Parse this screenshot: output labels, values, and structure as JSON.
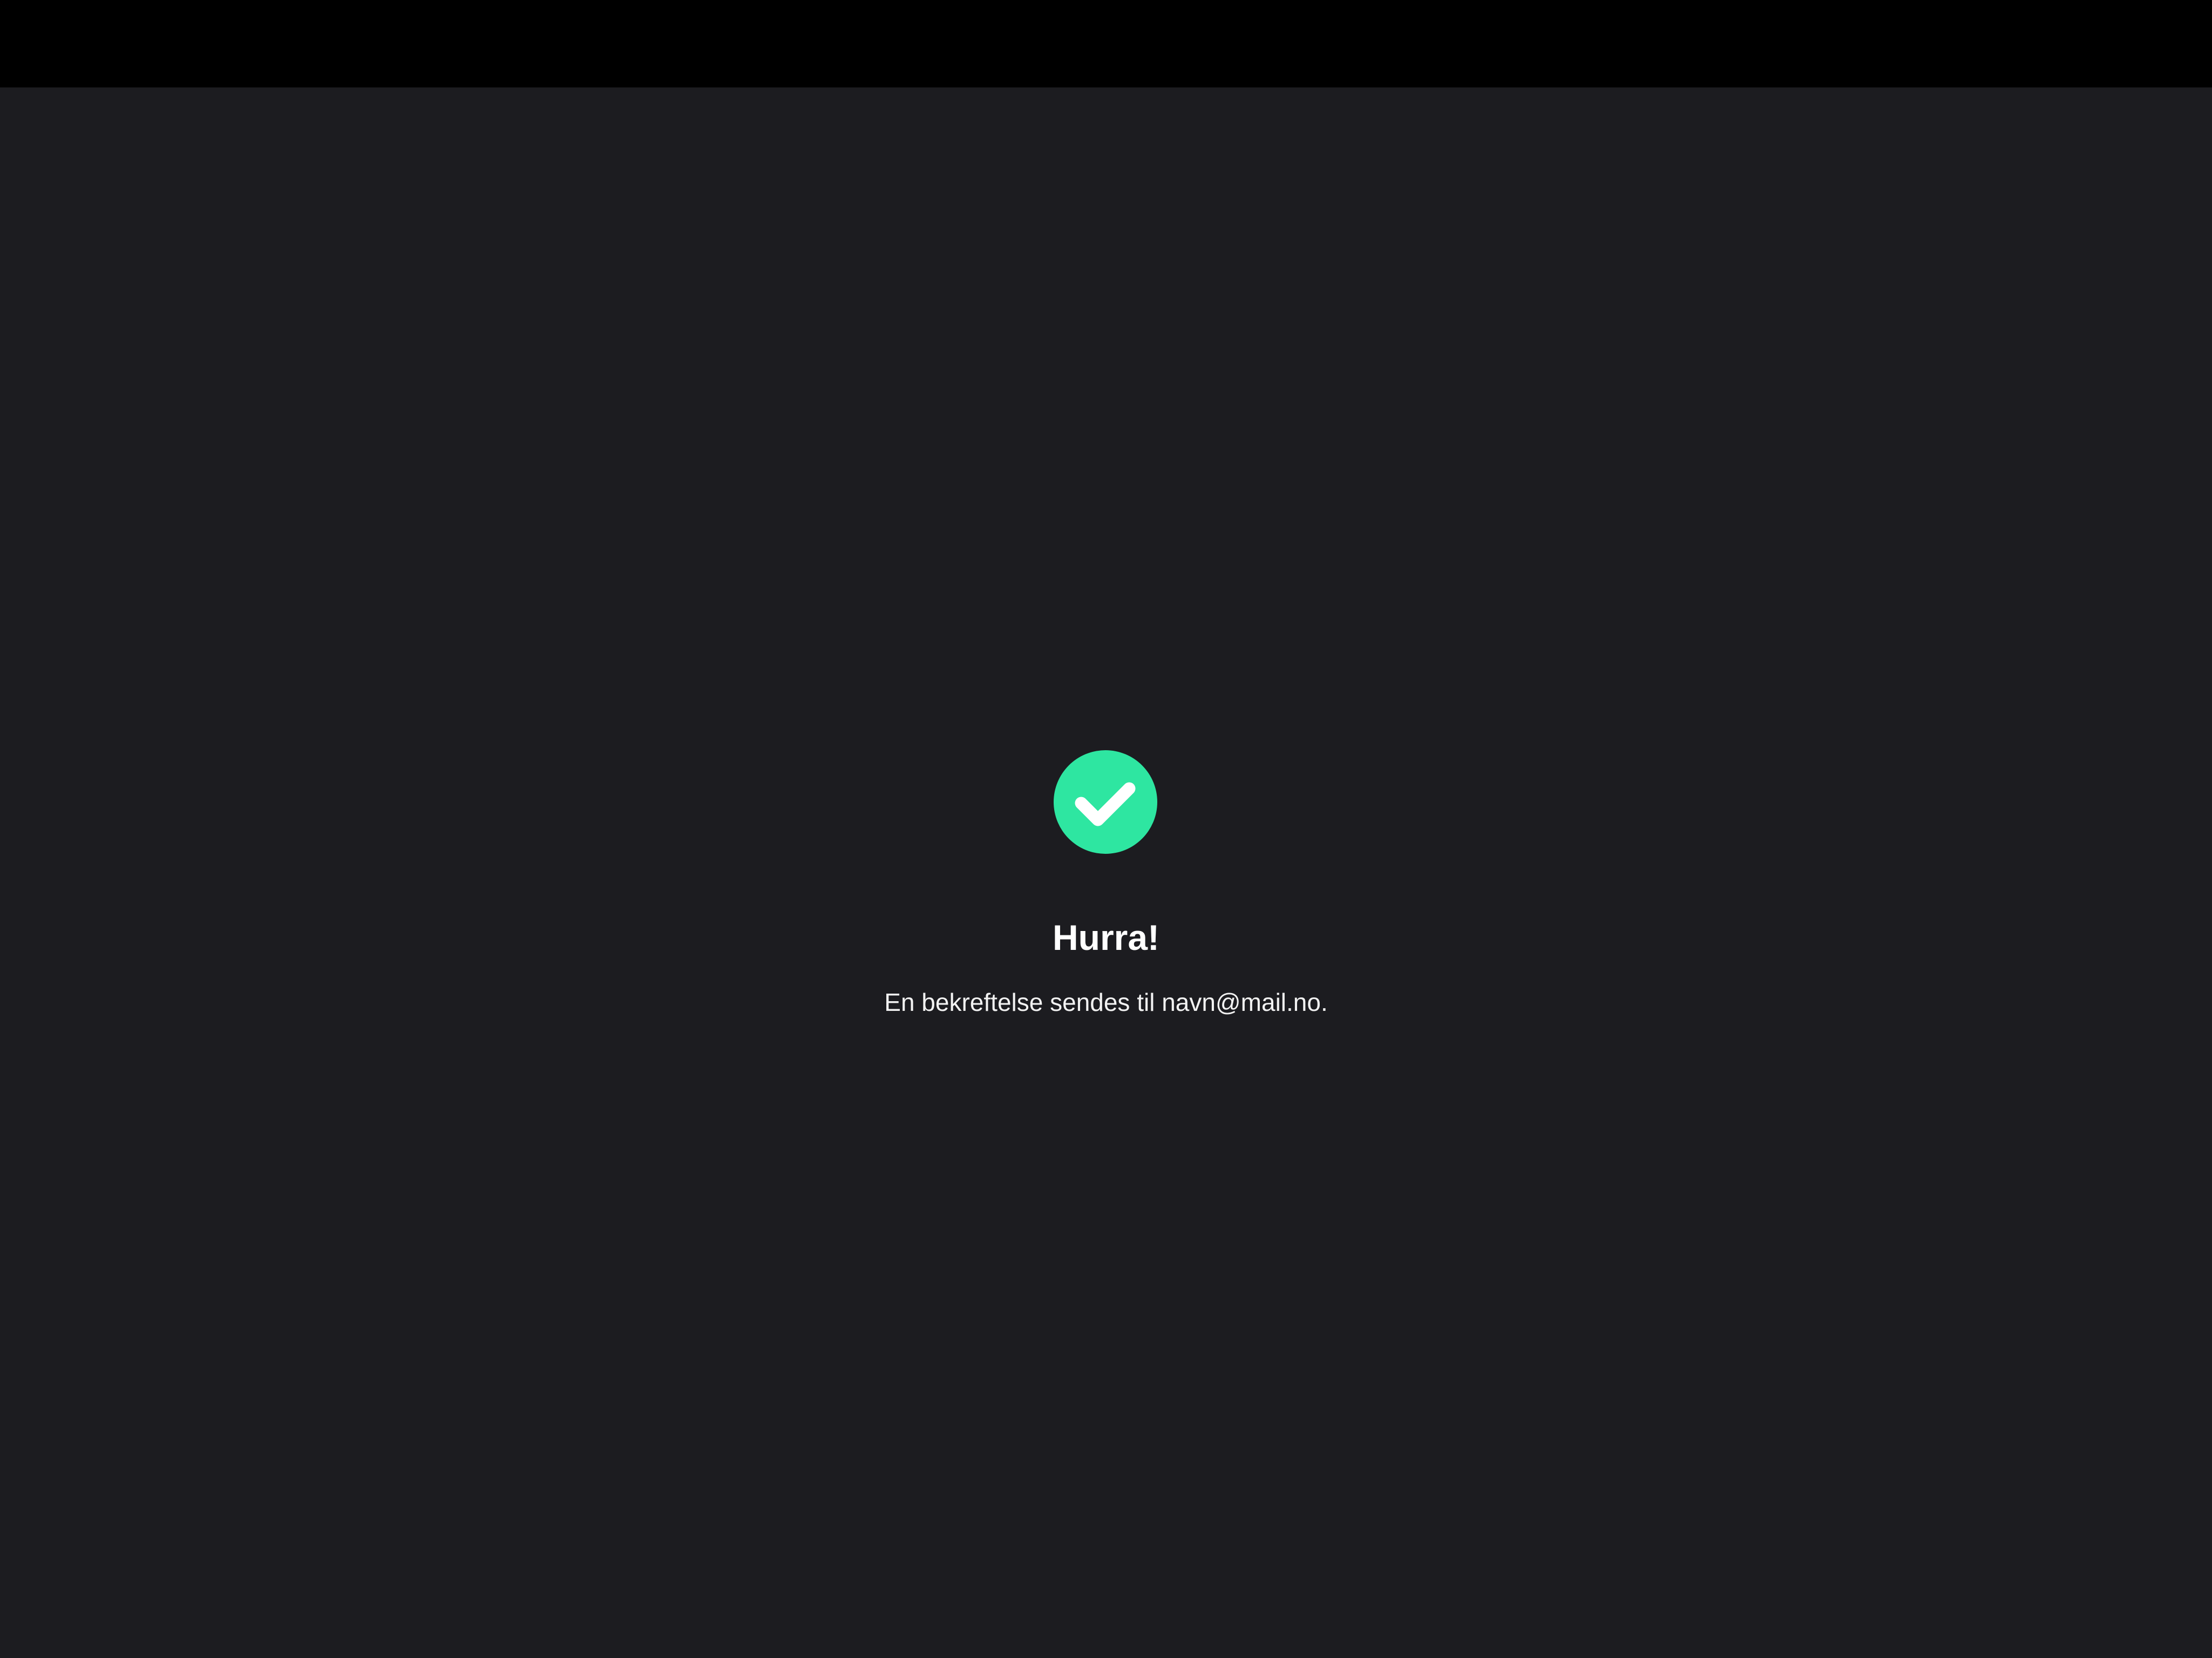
{
  "confirmation": {
    "title": "Hurra!",
    "message": "En bekreftelse sendes til navn@mail.no.",
    "icon": "check-circle-icon",
    "accent_color": "#2ee6a1"
  },
  "colors": {
    "status_bar": "#000000",
    "background": "#1c1c20",
    "text": "#ffffff"
  }
}
